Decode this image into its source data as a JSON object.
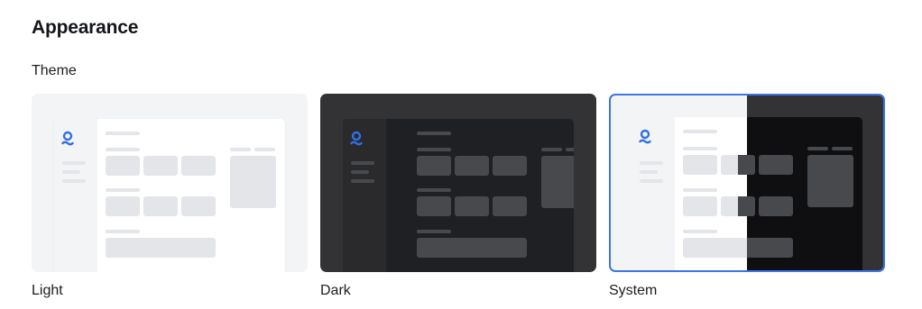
{
  "page": {
    "title": "Appearance",
    "section_label": "Theme"
  },
  "themes": [
    {
      "id": "light",
      "label": "Light",
      "selected": false
    },
    {
      "id": "dark",
      "label": "Dark",
      "selected": false
    },
    {
      "id": "system",
      "label": "System",
      "selected": true
    }
  ],
  "colors": {
    "accent": "#3f74e8",
    "logo_blue": "#2f6fe6",
    "light_bg": "#f3f4f6",
    "dark_bg": "#333335",
    "dark_window": "#1f2023"
  },
  "icons": {
    "logo": "app-logo-icon"
  }
}
